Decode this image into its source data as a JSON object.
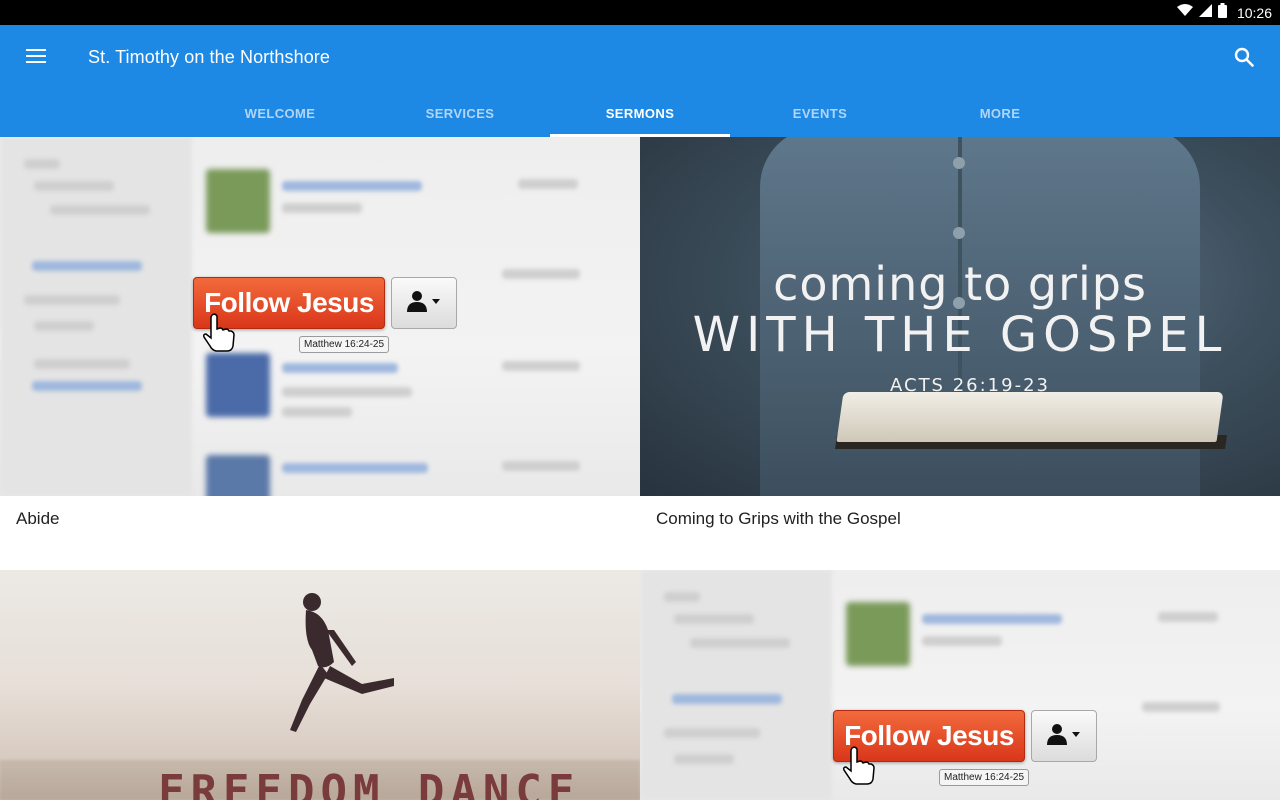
{
  "status": {
    "time": "10:26"
  },
  "appbar": {
    "title": "St. Timothy on the Northshore"
  },
  "tabs": [
    {
      "label": "WELCOME"
    },
    {
      "label": "SERVICES"
    },
    {
      "label": "SERMONS"
    },
    {
      "label": "EVENTS"
    },
    {
      "label": "MORE"
    }
  ],
  "active_tab": "SERMONS",
  "sermons": [
    {
      "title": "Abide",
      "image": {
        "button": "Follow Jesus",
        "reference": "Matthew 16:24-25"
      }
    },
    {
      "title": "Coming to Grips with the Gospel",
      "image": {
        "line1": "coming to grips",
        "line2": "WITH THE GOSPEL",
        "reference": "ACTS 26:19-23"
      }
    },
    {
      "title": "",
      "image": {
        "text": "FREEDOM DANCE"
      }
    },
    {
      "title": "",
      "image": {
        "button": "Follow Jesus",
        "reference": "Matthew 16:24-25"
      }
    }
  ],
  "colors": {
    "appbar": "#1e88e5",
    "statusbar": "#000000",
    "follow_button": "#e04420"
  }
}
